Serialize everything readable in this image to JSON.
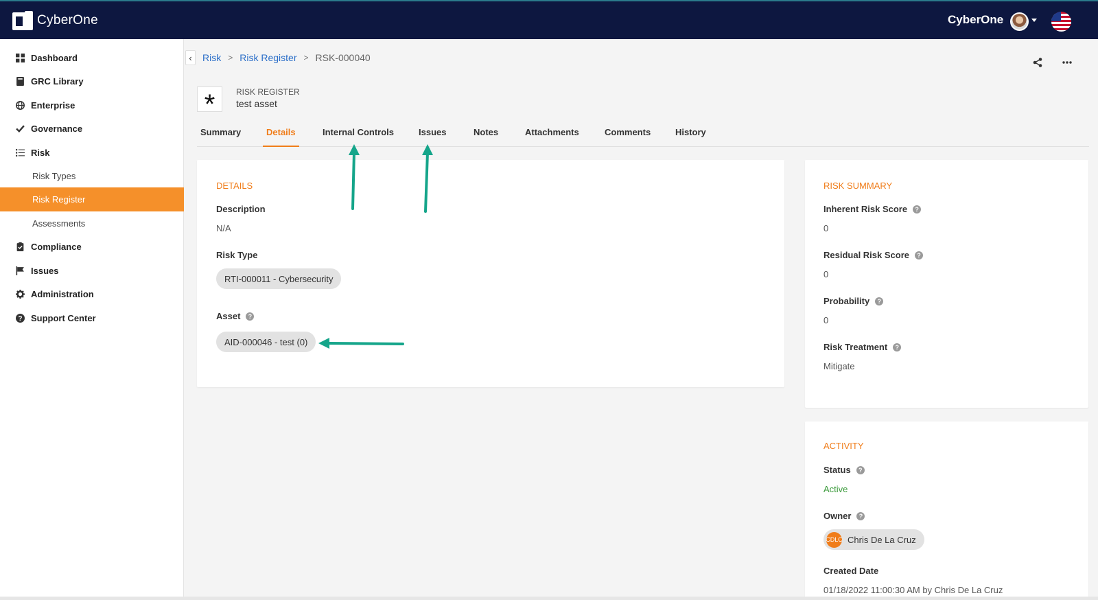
{
  "app": {
    "name": "CyberOne",
    "brand_right": "CyberOne"
  },
  "icons": {
    "avatar": "user-avatar",
    "flag": "us-flag-icon",
    "share": "share-icon",
    "more": "more-icon"
  },
  "sidebar": {
    "items": [
      {
        "label": "Dashboard",
        "icon": "grid-icon"
      },
      {
        "label": "GRC Library",
        "icon": "book-icon"
      },
      {
        "label": "Enterprise",
        "icon": "globe-icon"
      },
      {
        "label": "Governance",
        "icon": "check-icon"
      },
      {
        "label": "Risk",
        "icon": "list-icon"
      },
      {
        "label": "Risk Types"
      },
      {
        "label": "Risk Register",
        "active": true
      },
      {
        "label": "Assessments"
      },
      {
        "label": "Compliance",
        "icon": "clipboard-icon"
      },
      {
        "label": "Issues",
        "icon": "flag-icon"
      },
      {
        "label": "Administration",
        "icon": "gear-icon"
      },
      {
        "label": "Support Center",
        "icon": "question-icon"
      }
    ]
  },
  "breadcrumb": {
    "items": [
      "Risk",
      "Risk Register"
    ],
    "current": "RSK-000040",
    "sep": ">"
  },
  "record": {
    "type": "RISK REGISTER",
    "name": "test asset"
  },
  "tabs": [
    "Summary",
    "Details",
    "Internal Controls",
    "Issues",
    "Notes",
    "Attachments",
    "Comments",
    "History"
  ],
  "active_tab": "Details",
  "details": {
    "title": "DETAILS",
    "description_label": "Description",
    "description_value": "N/A",
    "risk_type_label": "Risk Type",
    "risk_type_value": "RTI-000011 - Cybersecurity",
    "asset_label": "Asset",
    "asset_value": "AID-000046 - test (0)"
  },
  "risk_summary": {
    "title": "RISK SUMMARY",
    "inherent_label": "Inherent Risk Score",
    "inherent_value": "0",
    "residual_label": "Residual Risk Score",
    "residual_value": "0",
    "probability_label": "Probability",
    "probability_value": "0",
    "treatment_label": "Risk Treatment",
    "treatment_value": "Mitigate"
  },
  "activity": {
    "title": "ACTIVITY",
    "status_label": "Status",
    "status_value": "Active",
    "owner_label": "Owner",
    "owner_initials": "CDLC",
    "owner_name": "Chris De La Cruz",
    "created_label": "Created Date",
    "created_value": "01/18/2022 11:00:30 AM by Chris De La Cruz"
  },
  "colors": {
    "accent": "#f07d1a",
    "topbar": "#0d1740",
    "link": "#2a6ec8",
    "arrow": "#15a58a",
    "active_status": "#3a9a3a"
  }
}
